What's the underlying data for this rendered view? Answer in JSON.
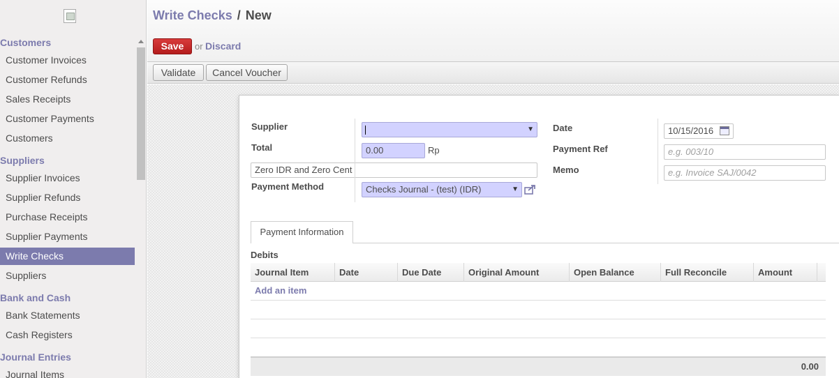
{
  "sidebar": {
    "sections": [
      {
        "title": "Customers",
        "items": [
          "Customer Invoices",
          "Customer Refunds",
          "Sales Receipts",
          "Customer Payments",
          "Customers"
        ]
      },
      {
        "title": "Suppliers",
        "items": [
          "Supplier Invoices",
          "Supplier Refunds",
          "Purchase Receipts",
          "Supplier Payments",
          "Write Checks",
          "Suppliers"
        ]
      },
      {
        "title": "Bank and Cash",
        "items": [
          "Bank Statements",
          "Cash Registers"
        ]
      },
      {
        "title": "Journal Entries",
        "items": [
          "Journal Items"
        ]
      }
    ],
    "active_item": "Write Checks"
  },
  "header": {
    "breadcrumb_parent": "Write Checks",
    "breadcrumb_separator": "/",
    "breadcrumb_current": "New",
    "save_label": "Save",
    "or_label": "or",
    "discard_label": "Discard",
    "validate_label": "Validate",
    "cancel_voucher_label": "Cancel Voucher"
  },
  "form": {
    "supplier_label": "Supplier",
    "supplier_value": "",
    "total_label": "Total",
    "total_value": "0.00",
    "currency": "Rp",
    "amount_in_words": "Zero IDR and Zero Cent",
    "payment_method_label": "Payment Method",
    "payment_method_value": "Checks Journal - (test) (IDR)",
    "date_label": "Date",
    "date_value": "10/15/2016",
    "payment_ref_label": "Payment Ref",
    "payment_ref_placeholder": "e.g. 003/10",
    "memo_label": "Memo",
    "memo_placeholder": "e.g. Invoice SAJ/0042"
  },
  "tabs": [
    {
      "label": "Payment Information",
      "active": true
    }
  ],
  "debits": {
    "title": "Debits",
    "columns": [
      "Journal Item",
      "Date",
      "Due Date",
      "Original Amount",
      "Open Balance",
      "Full Reconcile",
      "Amount"
    ],
    "add_item_label": "Add an item",
    "total": "0.00"
  },
  "colors": {
    "accent": "#7c7bad",
    "save_button": "#c62828",
    "required_field": "#d2d2ff"
  }
}
